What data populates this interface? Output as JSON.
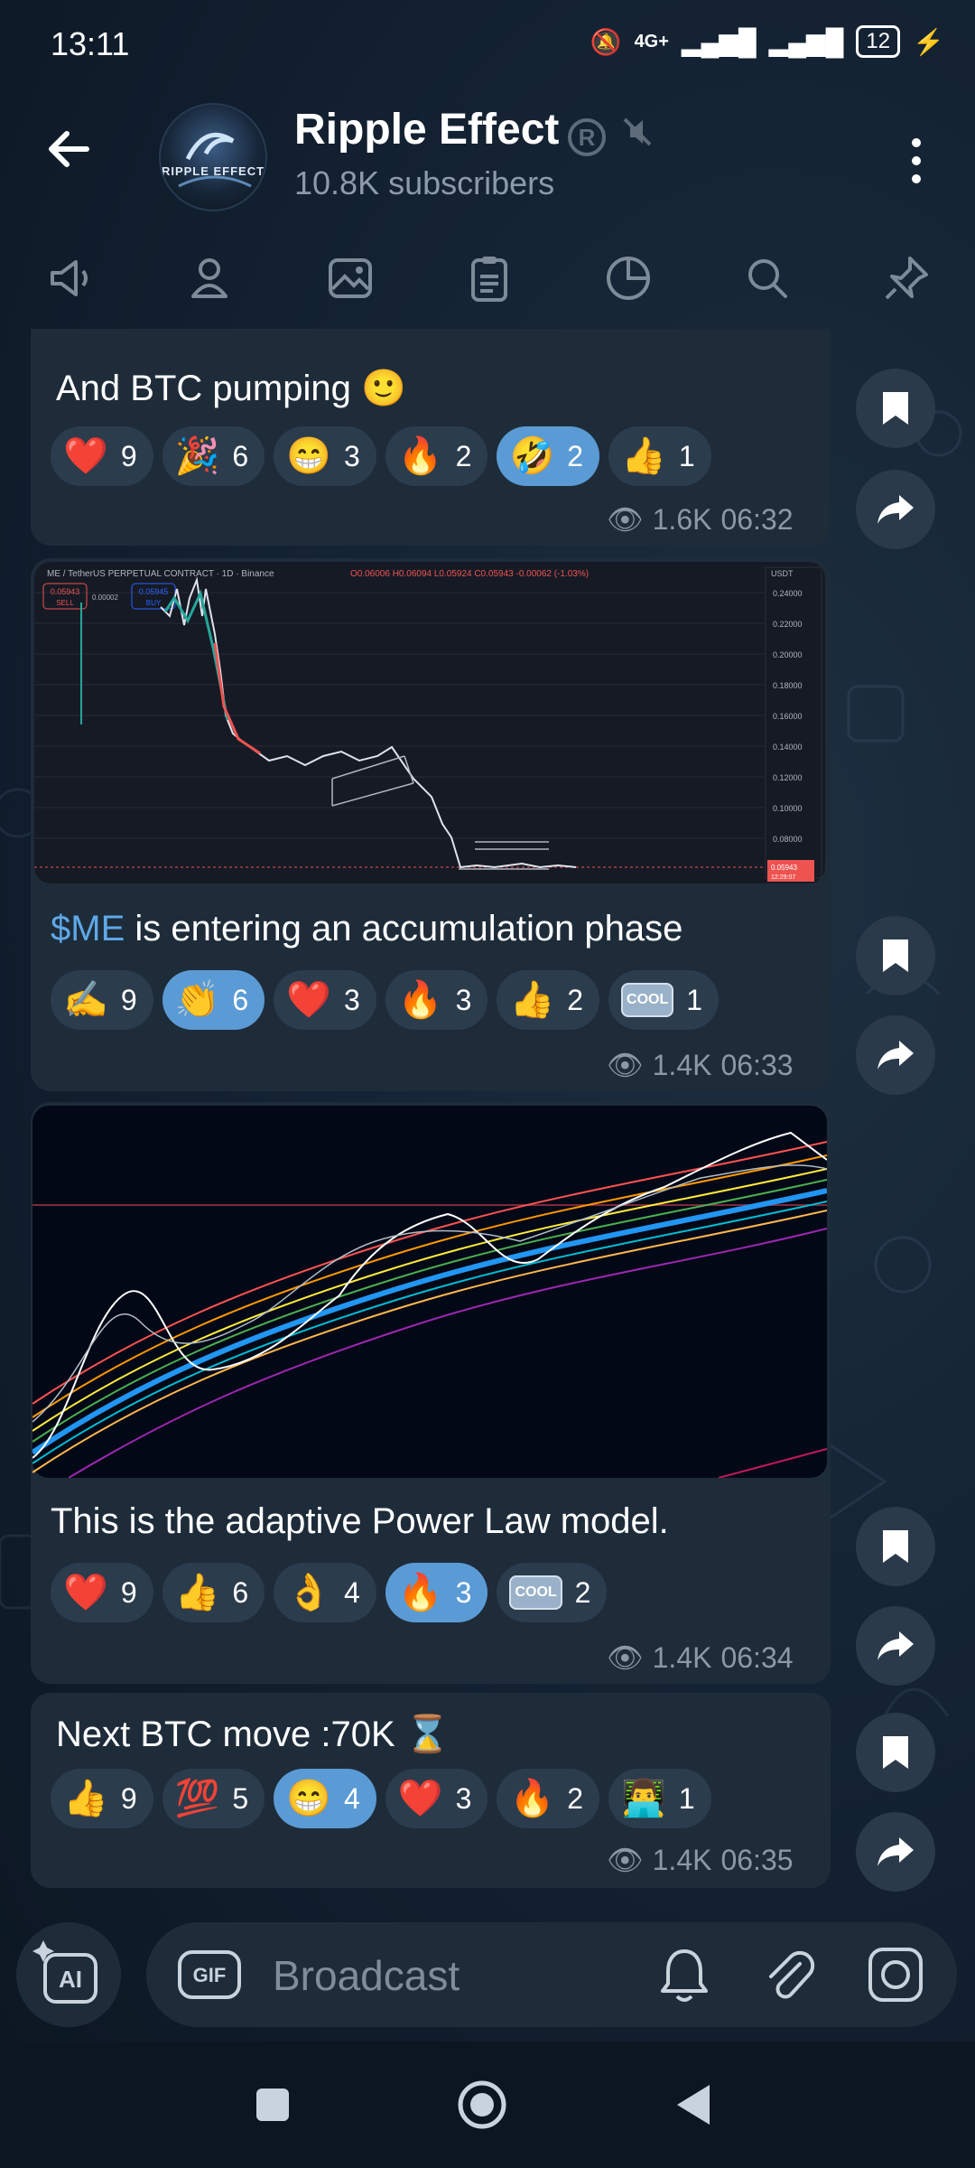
{
  "status": {
    "time": "13:11",
    "network": "4G+",
    "battery": "12"
  },
  "header": {
    "channel_name": "Ripple Effect",
    "subscribers": "10.8K subscribers",
    "avatar_text": "RIPPLE EFFECT"
  },
  "tabs": [
    "megaphone-icon",
    "person-icon",
    "image-icon",
    "clipboard-icon",
    "pie-chart-icon",
    "search-icon",
    "pin-icon"
  ],
  "messages": [
    {
      "text": "And BTC pumping 🙂",
      "reactions": [
        {
          "emoji": "❤️",
          "count": "9",
          "active": false
        },
        {
          "emoji": "🎉",
          "count": "6",
          "active": false
        },
        {
          "emoji": "😁",
          "count": "3",
          "active": false
        },
        {
          "emoji": "🔥",
          "count": "2",
          "active": false
        },
        {
          "emoji": "🤣",
          "count": "2",
          "active": true
        },
        {
          "emoji": "👍",
          "count": "1",
          "active": false
        }
      ],
      "views": "1.6K",
      "time": "06:32"
    },
    {
      "ticker": "$ME",
      "text": " is entering an accumulation phase",
      "chart": {
        "title": "ME / TetherUS PERPETUAL CONTRACT · 1D · Binance",
        "ohlc": "O0.06006 H0.06094 L0.05924 C0.05943 -0.00062 (-1.03%)",
        "sell": "0.05943",
        "sell_label": "SELL",
        "buy": "0.05945",
        "buy_label": "BUY",
        "spread": "0.00002",
        "currency": "USDT",
        "y_ticks": [
          "0.24000",
          "0.22000",
          "0.20000",
          "0.18000",
          "0.16000",
          "0.14000",
          "0.12000",
          "0.10000",
          "0.08000"
        ],
        "last_price": "0.05943",
        "last_time": "12:29:07"
      },
      "reactions": [
        {
          "emoji": "✍️",
          "count": "9",
          "active": false
        },
        {
          "emoji": "👏",
          "count": "6",
          "active": true
        },
        {
          "emoji": "❤️",
          "count": "3",
          "active": false
        },
        {
          "emoji": "🔥",
          "count": "3",
          "active": false
        },
        {
          "emoji": "👍",
          "count": "2",
          "active": false
        },
        {
          "emoji": "COOL",
          "count": "1",
          "active": false
        }
      ],
      "views": "1.4K",
      "time": "06:33"
    },
    {
      "text": "This is the adaptive Power Law model.",
      "reactions": [
        {
          "emoji": "❤️",
          "count": "9",
          "active": false
        },
        {
          "emoji": "👍",
          "count": "6",
          "active": false
        },
        {
          "emoji": "👌",
          "count": "4",
          "active": false
        },
        {
          "emoji": "🔥",
          "count": "3",
          "active": true
        },
        {
          "emoji": "COOL",
          "count": "2",
          "active": false
        }
      ],
      "views": "1.4K",
      "time": "06:34"
    },
    {
      "text": "Next BTC move :70K ⌛",
      "reactions": [
        {
          "emoji": "👍",
          "count": "9",
          "active": false
        },
        {
          "emoji": "💯",
          "count": "5",
          "active": false
        },
        {
          "emoji": "😁",
          "count": "4",
          "active": true
        },
        {
          "emoji": "❤️",
          "count": "3",
          "active": false
        },
        {
          "emoji": "🔥",
          "count": "2",
          "active": false
        },
        {
          "emoji": "👨‍💻",
          "count": "1",
          "active": false
        }
      ],
      "views": "1.4K",
      "time": "06:35"
    }
  ],
  "input": {
    "placeholder": "Broadcast",
    "gif_label": "GIF",
    "ai_label": "AI"
  },
  "colors": {
    "accent": "#5b9bd5",
    "bubble": "#1e2c3a",
    "ticker": "#5ea8e8"
  }
}
